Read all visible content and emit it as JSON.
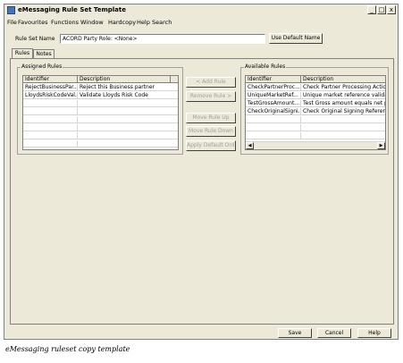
{
  "window": {
    "title": "eMessaging Rule Set Template",
    "minimize_glyph": "_",
    "maximize_glyph": "□",
    "close_glyph": "x"
  },
  "menu": {
    "items": [
      "File",
      "Favourites",
      "Functions",
      "Window",
      "Hardcopy",
      "Help",
      "Search"
    ]
  },
  "rule_set": {
    "label": "Rule Set Name",
    "value": "ACORD Party Role: <None>",
    "default_button": "Use Default Name"
  },
  "tabs": [
    "Rules",
    "Notes"
  ],
  "assigned": {
    "title": "Assigned Rules",
    "columns": [
      "Identifier",
      "Description"
    ],
    "rows": [
      [
        "RejectBusinessPar...",
        "Reject this Business partner"
      ],
      [
        "LloydsRiskCodeVal...",
        "Validate Lloyds Risk Code"
      ]
    ]
  },
  "available": {
    "title": "Available Rules",
    "columns": [
      "Identifier",
      "Description"
    ],
    "rows": [
      [
        "CheckPartnerProc...",
        "Check Partner Processing Action"
      ],
      [
        "UniqueMarketRef...",
        "Unique market reference validation"
      ],
      [
        "TestGrossAmount...",
        "Test Gross amount equals net pre..."
      ],
      [
        "CheckOriginalSigni...",
        "Check Original Signing Reference"
      ]
    ]
  },
  "middle_buttons": {
    "add": "< Add Rule",
    "remove": "Remove Rule >",
    "move_up": "Move Rule Up",
    "move_down": "Move Rule Down",
    "apply_default": "Apply Default Order"
  },
  "footer": {
    "save": "Save",
    "cancel": "Cancel",
    "help": "Help"
  },
  "caption": "eMessaging ruleset copy template",
  "colors": {
    "window_bg": "#ece9d8",
    "title_icon": "#4a74b8"
  }
}
